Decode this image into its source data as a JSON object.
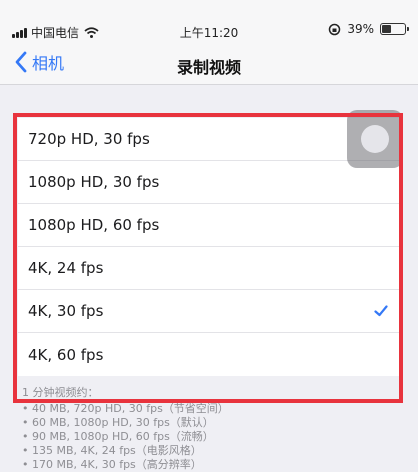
{
  "status_bar": {
    "carrier": "中国电信",
    "time": "上午11:20",
    "battery_percent": "39%",
    "battery_level": 0.39
  },
  "nav": {
    "back_label": "相机",
    "title": "录制视频"
  },
  "options": [
    {
      "label": "720p HD, 30 fps",
      "selected": false
    },
    {
      "label": "1080p HD, 30 fps",
      "selected": false
    },
    {
      "label": "1080p HD, 60 fps",
      "selected": false
    },
    {
      "label": "4K, 24 fps",
      "selected": false
    },
    {
      "label": "4K, 30 fps",
      "selected": true
    },
    {
      "label": "4K, 60 fps",
      "selected": false
    }
  ],
  "footer": {
    "label": "1 分钟视频约：",
    "items": [
      "• 40 MB, 720p HD, 30 fps（节省空间）",
      "• 60 MB, 1080p HD, 30 fps（默认）",
      "• 90 MB, 1080p HD, 60 fps（流畅）",
      "• 135 MB, 4K, 24 fps（电影风格）",
      "• 170 MB, 4K, 30 fps（高分辨率）"
    ]
  },
  "colors": {
    "accent": "#3478f6",
    "highlight": "#e8333d"
  },
  "icons": {
    "back": "chevron-left-icon",
    "selected": "checkmark-icon",
    "wifi": "wifi-icon",
    "lock": "orientation-lock-icon",
    "battery": "battery-icon"
  }
}
